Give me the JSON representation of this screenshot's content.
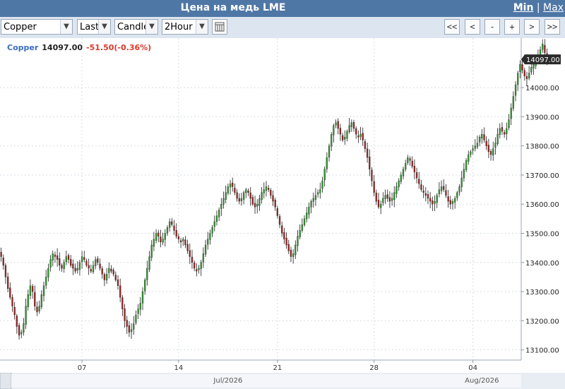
{
  "window": {
    "title": "Цена на медь LME",
    "min_label": "Min",
    "separator": "|",
    "max_label": "Max"
  },
  "toolbar": {
    "symbol": "Copper",
    "price_field": "Last",
    "chart_type": "Candle",
    "interval": "2Hour",
    "nav_buttons": [
      "<<",
      "<",
      "-",
      "+",
      ">",
      ">>"
    ]
  },
  "colors": {
    "title_bar": "#4f77a6",
    "up_candle": "#2e9b2e",
    "down_candle": "#9b2424",
    "header_symbol": "#3a6bc4",
    "header_change": "#d93a2b",
    "last_price_label_bg": "#2b2b2b"
  },
  "chart_data": {
    "type": "candlestick",
    "symbol": "Copper",
    "header": {
      "symbol": "Copper",
      "last": "14097.00",
      "change": "-51.50(-0.36%)"
    },
    "last_price_label": "14097.00",
    "last_price": 14097,
    "ylim": [
      13065,
      14170
    ],
    "y_ticks": [
      13100,
      13200,
      13300,
      13400,
      13500,
      13600,
      13700,
      13800,
      13900,
      14000
    ],
    "y_tick_labels": [
      "13100.00",
      "13200.00",
      "13300.00",
      "13400.00",
      "13500.00",
      "13600.00",
      "13700.00",
      "13800.00",
      "13900.00",
      "14000.00"
    ],
    "x_tick_labels": [
      "07",
      "14",
      "21",
      "28",
      "04"
    ],
    "x_tick_candle_index": [
      36,
      79,
      123,
      166,
      210
    ],
    "month_labels": [
      "Jul/2026",
      "Aug/2026"
    ],
    "month_label_candle_index": [
      101,
      214
    ],
    "grid": true,
    "n_candles": 232,
    "closes": [
      13420,
      13390,
      13350,
      13310,
      13280,
      13250,
      13220,
      13180,
      13150,
      13160,
      13190,
      13250,
      13290,
      13320,
      13300,
      13250,
      13230,
      13250,
      13290,
      13320,
      13350,
      13380,
      13410,
      13430,
      13420,
      13410,
      13390,
      13380,
      13400,
      13420,
      13410,
      13390,
      13380,
      13370,
      13380,
      13400,
      13420,
      13410,
      13390,
      13380,
      13370,
      13390,
      13410,
      13400,
      13380,
      13360,
      13340,
      13360,
      13380,
      13370,
      13360,
      13340,
      13320,
      13280,
      13240,
      13200,
      13180,
      13160,
      13170,
      13190,
      13220,
      13240,
      13260,
      13300,
      13340,
      13380,
      13420,
      13460,
      13480,
      13500,
      13490,
      13470,
      13480,
      13500,
      13520,
      13540,
      13530,
      13510,
      13490,
      13480,
      13470,
      13480,
      13460,
      13440,
      13420,
      13400,
      13380,
      13370,
      13380,
      13400,
      13430,
      13460,
      13480,
      13500,
      13520,
      13540,
      13560,
      13580,
      13600,
      13620,
      13640,
      13660,
      13670,
      13660,
      13640,
      13620,
      13610,
      13620,
      13640,
      13650,
      13640,
      13620,
      13600,
      13590,
      13600,
      13620,
      13640,
      13650,
      13660,
      13650,
      13630,
      13610,
      13590,
      13560,
      13530,
      13500,
      13480,
      13460,
      13440,
      13420,
      13430,
      13460,
      13490,
      13510,
      13530,
      13550,
      13570,
      13590,
      13610,
      13620,
      13630,
      13640,
      13650,
      13680,
      13720,
      13760,
      13800,
      13840,
      13870,
      13880,
      13860,
      13840,
      13820,
      13830,
      13850,
      13870,
      13880,
      13860,
      13840,
      13830,
      13840,
      13820,
      13790,
      13760,
      13720,
      13680,
      13640,
      13610,
      13590,
      13600,
      13620,
      13630,
      13620,
      13610,
      13620,
      13640,
      13660,
      13680,
      13700,
      13720,
      13740,
      13760,
      13750,
      13730,
      13710,
      13690,
      13670,
      13650,
      13640,
      13630,
      13620,
      13610,
      13600,
      13610,
      13630,
      13650,
      13660,
      13650,
      13630,
      13610,
      13600,
      13610,
      13620,
      13640,
      13660,
      13690,
      13720,
      13750,
      13770,
      13780,
      13790,
      13800,
      13810,
      13830,
      13840,
      13820,
      13800,
      13780,
      13770,
      13790,
      13810,
      13840,
      13860,
      13850,
      13840,
      13860,
      13890,
      13930,
      13970,
      14010,
      14050,
      14080,
      14060,
      14040,
      14030,
      14050,
      14070,
      14080,
      14090,
      14110,
      14130,
      14150,
      14120,
      14097
    ]
  }
}
